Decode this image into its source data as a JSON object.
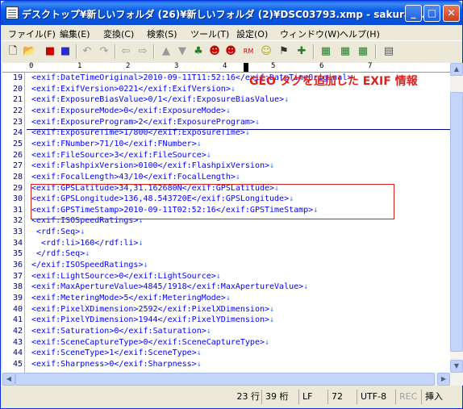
{
  "window": {
    "title": "デスクトップ¥新しいフォルダ (26)¥新しいフォルダ (2)¥DSC03793.xmp - sakura ...",
    "minimize": "_",
    "maximize": "□",
    "close": "✕"
  },
  "menu": [
    "ファイル(F)",
    "編集(E)",
    "変換(C)",
    "検索(S)",
    "ツール(T)",
    "設定(O)",
    "ウィンドウ(W)",
    "ヘルプ(H)"
  ],
  "toolbar": {
    "icons": [
      "new-file-icon",
      "open-file-icon",
      "save-icon",
      "save-as-icon",
      "undo-icon",
      "redo-icon",
      "back-icon",
      "forward-icon",
      "search-prev-icon",
      "search-next-icon",
      "grep-icon",
      "jump-icon",
      "clear-marks-icon",
      "bookmark-icon",
      "compare-icon",
      "outline-icon",
      "settings-icon",
      "font-icon",
      "properties-icon"
    ]
  },
  "ruler": {
    "labels": [
      "0",
      "1",
      "2",
      "3",
      "4",
      "5",
      "6",
      "7"
    ]
  },
  "editor": {
    "lines": [
      {
        "n": "19",
        "text": "<exif:DateTimeOriginal>2010-09-11T11:52:16</exif:DateTimeOriginal>"
      },
      {
        "n": "20",
        "text": "<exif:ExifVersion>0221</exif:ExifVersion>"
      },
      {
        "n": "21",
        "text": "<exif:ExposureBiasValue>0/1</exif:ExposureBiasValue>"
      },
      {
        "n": "22",
        "text": "<exif:ExposureMode>0</exif:ExposureMode>"
      },
      {
        "n": "23",
        "text": "<exif:ExposureProgram>2</exif:ExposureProgram>"
      },
      {
        "n": "24",
        "text": "<exif:ExposureTime>1/800</exif:ExposureTime>"
      },
      {
        "n": "25",
        "text": "<exif:FNumber>71/10</exif:FNumber>"
      },
      {
        "n": "26",
        "text": "<exif:FileSource>3</exif:FileSource>"
      },
      {
        "n": "27",
        "text": "<exif:FlashpixVersion>0100</exif:FlashpixVersion>"
      },
      {
        "n": "28",
        "text": "<exif:FocalLength>43/10</exif:FocalLength>"
      },
      {
        "n": "29",
        "text": "<exif:GPSLatitude>34,31.162680N</exif:GPSLatitude>"
      },
      {
        "n": "30",
        "text": "<exif:GPSLongitude>136,48.543720E</exif:GPSLongitude>"
      },
      {
        "n": "31",
        "text": "<exif:GPSTimeStamp>2010-09-11T02:52:16</exif:GPSTimeStamp>"
      },
      {
        "n": "32",
        "text": "<exif:ISOSpeedRatings>"
      },
      {
        "n": "33",
        "text": " <rdf:Seq>"
      },
      {
        "n": "34",
        "text": "  <rdf:li>160</rdf:li>"
      },
      {
        "n": "35",
        "text": " </rdf:Seq>"
      },
      {
        "n": "36",
        "text": "</exif:ISOSpeedRatings>"
      },
      {
        "n": "37",
        "text": "<exif:LightSource>0</exif:LightSource>"
      },
      {
        "n": "38",
        "text": "<exif:MaxApertureValue>4845/1918</exif:MaxApertureValue>"
      },
      {
        "n": "39",
        "text": "<exif:MeteringMode>5</exif:MeteringMode>"
      },
      {
        "n": "40",
        "text": "<exif:PixelXDimension>2592</exif:PixelXDimension>"
      },
      {
        "n": "41",
        "text": "<exif:PixelYDimension>1944</exif:PixelYDimension>"
      },
      {
        "n": "42",
        "text": "<exif:Saturation>0</exif:Saturation>"
      },
      {
        "n": "43",
        "text": "<exif:SceneCaptureType>0</exif:SceneCaptureType>"
      },
      {
        "n": "44",
        "text": "<exif:SceneType>1</exif:SceneType>"
      },
      {
        "n": "45",
        "text": "<exif:Sharpness>0</exif:Sharpness>"
      }
    ],
    "eol_mark": "↓",
    "annotation": "GEO タグを追加した EXIF 情報"
  },
  "status": {
    "line": "23 行",
    "column": "39 桁",
    "eol": "LF",
    "code": "72",
    "encoding": "UTF-8",
    "rec": "REC",
    "mode": "挿入"
  },
  "colors": {
    "text": "#0000ff",
    "line_numbers": "#000080",
    "annotation": "#e0201c"
  }
}
